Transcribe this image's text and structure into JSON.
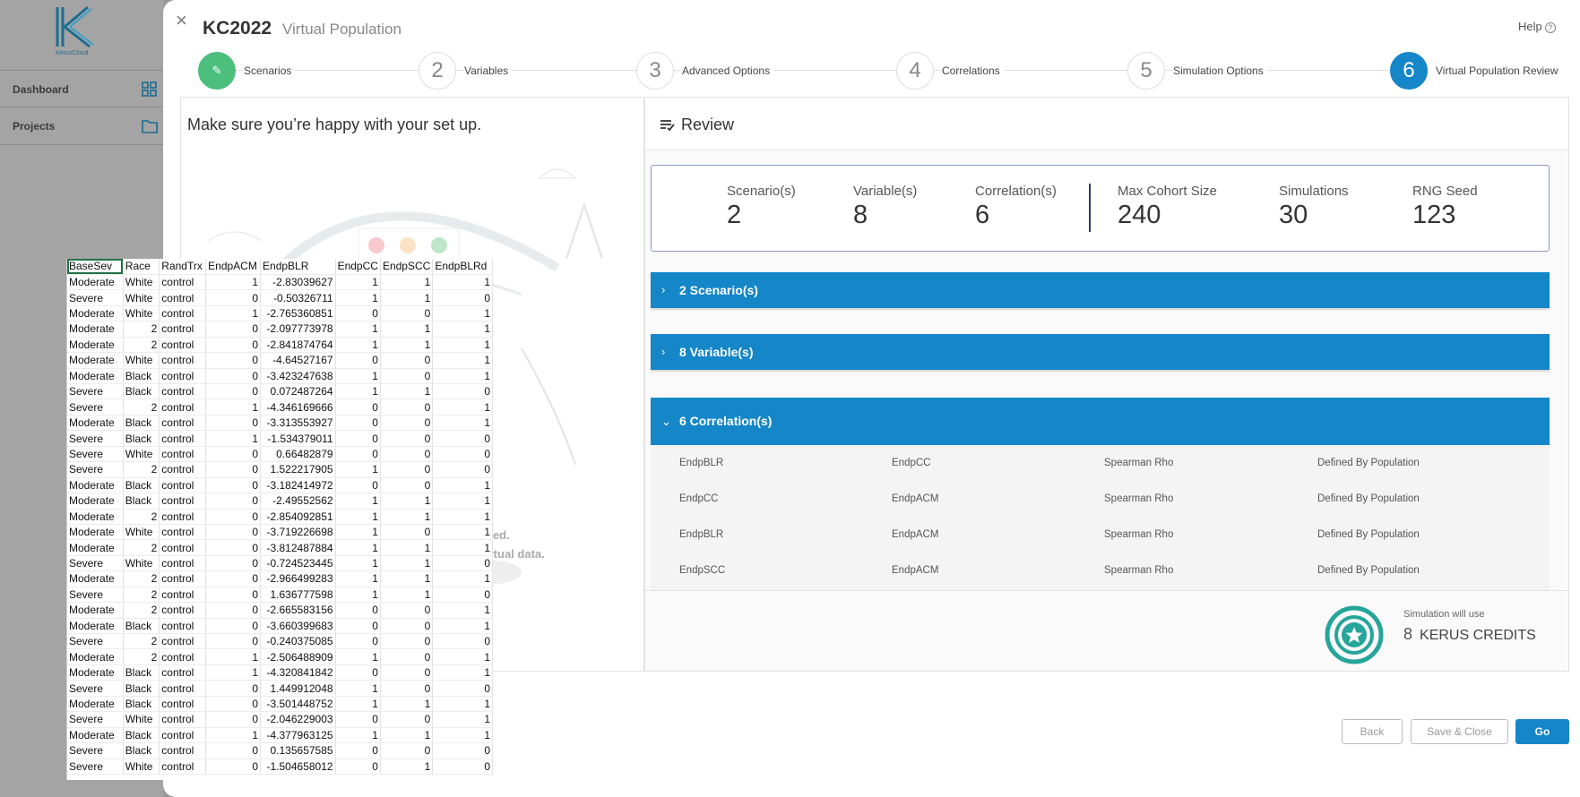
{
  "app": {
    "logo_text": "KerusCloud",
    "nav": [
      {
        "label": "Dashboard",
        "icon": "grid-icon"
      },
      {
        "label": "Projects",
        "icon": "folder-icon"
      }
    ]
  },
  "modal": {
    "title": "KC2022",
    "subtitle": "Virtual Population",
    "help": "Help",
    "close": "×"
  },
  "steps": [
    {
      "num": "✎",
      "label": "Scenarios",
      "state": "done"
    },
    {
      "num": "2",
      "label": "Variables",
      "state": "todo"
    },
    {
      "num": "3",
      "label": "Advanced Options",
      "state": "todo"
    },
    {
      "num": "4",
      "label": "Correlations",
      "state": "todo"
    },
    {
      "num": "5",
      "label": "Simulation Options",
      "state": "todo"
    },
    {
      "num": "6",
      "label": "Virtual Population Review",
      "state": "active"
    }
  ],
  "left": {
    "title": "Make sure you’re happy with your set up.",
    "note_line1": "ned.",
    "note_line2": "irtual data."
  },
  "review": {
    "heading": "Review",
    "stats": [
      {
        "label": "Scenario(s)",
        "value": "2"
      },
      {
        "label": "Variable(s)",
        "value": "8"
      },
      {
        "label": "Correlation(s)",
        "value": "6"
      },
      {
        "label": "Max Cohort Size",
        "value": "240"
      },
      {
        "label": "Simulations",
        "value": "30"
      },
      {
        "label": "RNG Seed",
        "value": "123"
      }
    ],
    "sections": [
      {
        "chevron": "›",
        "label": "2 Scenario(s)"
      },
      {
        "chevron": "›",
        "label": "8 Variable(s)"
      },
      {
        "chevron": "⌄",
        "label": "6 Correlation(s)"
      }
    ],
    "correlations": [
      [
        "EndpBLR",
        "EndpCC",
        "Spearman Rho",
        "Defined By Population"
      ],
      [
        "EndpCC",
        "EndpACM",
        "Spearman Rho",
        "Defined By Population"
      ],
      [
        "EndpBLR",
        "EndpACM",
        "Spearman Rho",
        "Defined By Population"
      ],
      [
        "EndpSCC",
        "EndpACM",
        "Spearman Rho",
        "Defined By Population"
      ]
    ],
    "credits_note": "Simulation will use",
    "credits_value": "8",
    "credits_unit": "KERUS CREDITS"
  },
  "buttons": {
    "back": "Back",
    "save_close": "Save & Close",
    "go": "Go"
  },
  "sheet": {
    "headers": [
      "BaseSev",
      "Race",
      "RandTrx",
      "EndpACM",
      "EndpBLR",
      "EndpCC",
      "EndpSCC",
      "EndpBLRd"
    ],
    "rows": [
      [
        "Moderate",
        "White",
        "control",
        "1",
        "-2.83039627",
        "1",
        "1",
        "1"
      ],
      [
        "Severe",
        "White",
        "control",
        "0",
        "-0.50326711",
        "1",
        "1",
        "0"
      ],
      [
        "Moderate",
        "White",
        "control",
        "1",
        "-2.765360851",
        "0",
        "0",
        "1"
      ],
      [
        "Moderate",
        "2",
        "control",
        "0",
        "-2.097773978",
        "1",
        "1",
        "1"
      ],
      [
        "Moderate",
        "2",
        "control",
        "0",
        "-2.841874764",
        "1",
        "1",
        "1"
      ],
      [
        "Moderate",
        "White",
        "control",
        "0",
        "-4.64527167",
        "0",
        "0",
        "1"
      ],
      [
        "Moderate",
        "Black",
        "control",
        "0",
        "-3.423247638",
        "1",
        "0",
        "1"
      ],
      [
        "Severe",
        "Black",
        "control",
        "0",
        "0.072487264",
        "1",
        "1",
        "0"
      ],
      [
        "Severe",
        "2",
        "control",
        "1",
        "-4.346169666",
        "0",
        "0",
        "1"
      ],
      [
        "Moderate",
        "Black",
        "control",
        "0",
        "-3.313553927",
        "0",
        "0",
        "1"
      ],
      [
        "Severe",
        "Black",
        "control",
        "1",
        "-1.534379011",
        "0",
        "0",
        "0"
      ],
      [
        "Severe",
        "White",
        "control",
        "0",
        "0.66482879",
        "0",
        "0",
        "0"
      ],
      [
        "Severe",
        "2",
        "control",
        "0",
        "1.522217905",
        "1",
        "0",
        "0"
      ],
      [
        "Moderate",
        "Black",
        "control",
        "0",
        "-3.182414972",
        "0",
        "0",
        "1"
      ],
      [
        "Moderate",
        "Black",
        "control",
        "0",
        "-2.49552562",
        "1",
        "1",
        "1"
      ],
      [
        "Moderate",
        "2",
        "control",
        "0",
        "-2.854092851",
        "1",
        "1",
        "1"
      ],
      [
        "Moderate",
        "White",
        "control",
        "0",
        "-3.719226698",
        "1",
        "0",
        "1"
      ],
      [
        "Moderate",
        "2",
        "control",
        "0",
        "-3.812487884",
        "1",
        "1",
        "1"
      ],
      [
        "Severe",
        "White",
        "control",
        "0",
        "-0.724523445",
        "1",
        "1",
        "0"
      ],
      [
        "Moderate",
        "2",
        "control",
        "0",
        "-2.966499283",
        "1",
        "1",
        "1"
      ],
      [
        "Severe",
        "2",
        "control",
        "0",
        "1.636777598",
        "1",
        "1",
        "0"
      ],
      [
        "Moderate",
        "2",
        "control",
        "0",
        "-2.665583156",
        "0",
        "0",
        "1"
      ],
      [
        "Moderate",
        "Black",
        "control",
        "0",
        "-3.660399683",
        "0",
        "0",
        "1"
      ],
      [
        "Severe",
        "2",
        "control",
        "0",
        "-0.240375085",
        "0",
        "0",
        "0"
      ],
      [
        "Moderate",
        "2",
        "control",
        "1",
        "-2.506488909",
        "1",
        "0",
        "1"
      ],
      [
        "Moderate",
        "Black",
        "control",
        "1",
        "-4.320841842",
        "0",
        "0",
        "1"
      ],
      [
        "Severe",
        "Black",
        "control",
        "0",
        "1.449912048",
        "1",
        "0",
        "0"
      ],
      [
        "Moderate",
        "Black",
        "control",
        "0",
        "-3.501448752",
        "1",
        "1",
        "1"
      ],
      [
        "Severe",
        "White",
        "control",
        "0",
        "-2.046229003",
        "0",
        "0",
        "1"
      ],
      [
        "Moderate",
        "Black",
        "control",
        "1",
        "-4.377963125",
        "1",
        "1",
        "1"
      ],
      [
        "Severe",
        "Black",
        "control",
        "0",
        "0.135657585",
        "0",
        "0",
        "0"
      ],
      [
        "Severe",
        "White",
        "control",
        "0",
        "-1.504658012",
        "0",
        "1",
        "0"
      ]
    ]
  }
}
